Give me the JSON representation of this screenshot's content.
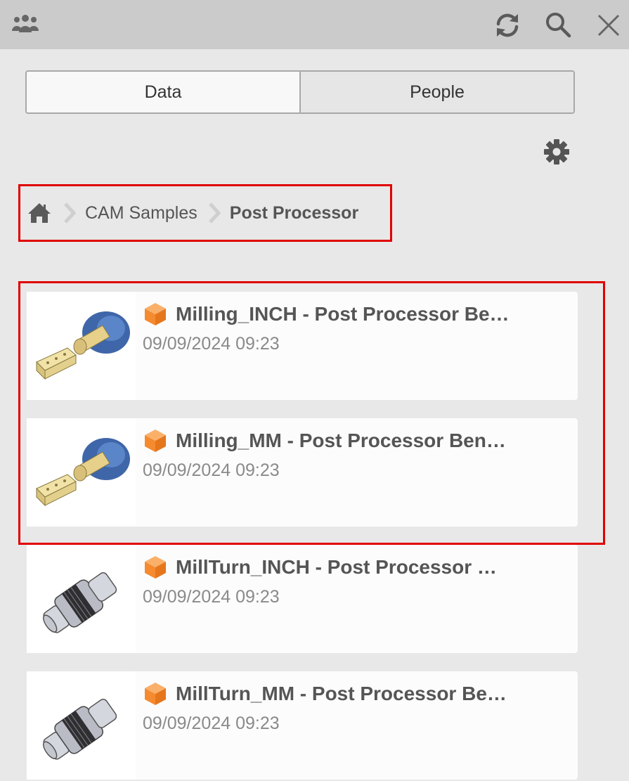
{
  "header": {
    "icons": {
      "team": "team-icon",
      "refresh": "refresh-icon",
      "search": "search-icon",
      "close": "close-icon"
    }
  },
  "tabs": [
    {
      "label": "Data",
      "active": true
    },
    {
      "label": "People",
      "active": false
    }
  ],
  "settings_icon": "gear-icon",
  "breadcrumb": {
    "home_icon": "home-icon",
    "items": [
      {
        "label": "CAM Samples"
      },
      {
        "label": "Post Processor"
      }
    ]
  },
  "files": [
    {
      "title": "Milling_INCH - Post Processor Be…",
      "date": "09/09/2024 09:23",
      "icon": "design-cube-icon",
      "thumbnail": "milling-part"
    },
    {
      "title": "Milling_MM - Post Processor Ben…",
      "date": "09/09/2024 09:23",
      "icon": "design-cube-icon",
      "thumbnail": "milling-part"
    },
    {
      "title": "MillTurn_INCH - Post Processor …",
      "date": "09/09/2024 09:23",
      "icon": "design-cube-icon",
      "thumbnail": "millturn-part"
    },
    {
      "title": "MillTurn_MM - Post Processor Be…",
      "date": "09/09/2024 09:23",
      "icon": "design-cube-icon",
      "thumbnail": "millturn-part"
    }
  ],
  "colors": {
    "topbar": "#cbcbcb",
    "background": "#e8e8e8",
    "highlight": "#e00000",
    "cube": "#f58a2f"
  }
}
